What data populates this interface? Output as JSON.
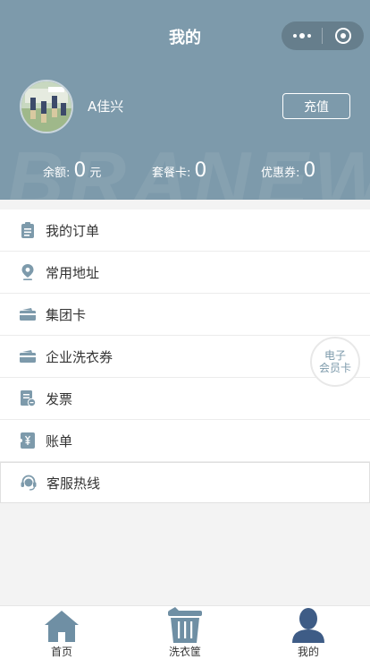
{
  "header": {
    "title": "我的",
    "watermark": "BRANEW",
    "username": "A佳兴",
    "recharge_label": "充值",
    "bg_color": "#7d9aab"
  },
  "stats": {
    "balance": {
      "label": "余额:",
      "value": "0",
      "unit": "元"
    },
    "package_card": {
      "label": "套餐卡:",
      "value": "0"
    },
    "coupon": {
      "label": "优惠券:",
      "value": "0"
    }
  },
  "menu": {
    "items": [
      {
        "label": "我的订单",
        "icon": "clipboard-icon"
      },
      {
        "label": "常用地址",
        "icon": "location-pin-icon"
      },
      {
        "label": "集团卡",
        "icon": "card-icon"
      },
      {
        "label": "企业洗衣券",
        "icon": "card-icon"
      },
      {
        "label": "发票",
        "icon": "invoice-icon"
      },
      {
        "label": "账单",
        "icon": "bill-icon"
      },
      {
        "label": "客服热线",
        "icon": "headset-icon"
      }
    ]
  },
  "floating": {
    "line1": "电子",
    "line2": "会员卡"
  },
  "tabbar": {
    "items": [
      {
        "label": "首页",
        "icon": "home-icon"
      },
      {
        "label": "洗衣筐",
        "icon": "laundry-basket-icon"
      },
      {
        "label": "我的",
        "icon": "person-icon"
      }
    ]
  }
}
